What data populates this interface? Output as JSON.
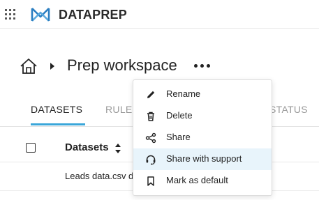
{
  "app": {
    "brand": "DATAPREP"
  },
  "breadcrumb": {
    "title": "Prep workspace"
  },
  "tabs": [
    {
      "label": "DATASETS",
      "active": true
    },
    {
      "label": "RULE",
      "active": false
    },
    {
      "label": "STATUS",
      "active": false
    }
  ],
  "table": {
    "column_header": "Datasets",
    "rows": [
      {
        "name": "Leads data.csv d"
      }
    ]
  },
  "menu": {
    "items": [
      {
        "label": "Rename",
        "icon": "pencil-icon"
      },
      {
        "label": "Delete",
        "icon": "trash-icon"
      },
      {
        "label": "Share",
        "icon": "share-icon"
      },
      {
        "label": "Share with support",
        "icon": "headset-icon",
        "highlighted": true
      },
      {
        "label": "Mark as default",
        "icon": "bookmark-icon"
      }
    ]
  },
  "colors": {
    "accent": "#3aa6d9",
    "menu_highlight": "#e8f4fb",
    "logo": "#2b7ec1"
  }
}
